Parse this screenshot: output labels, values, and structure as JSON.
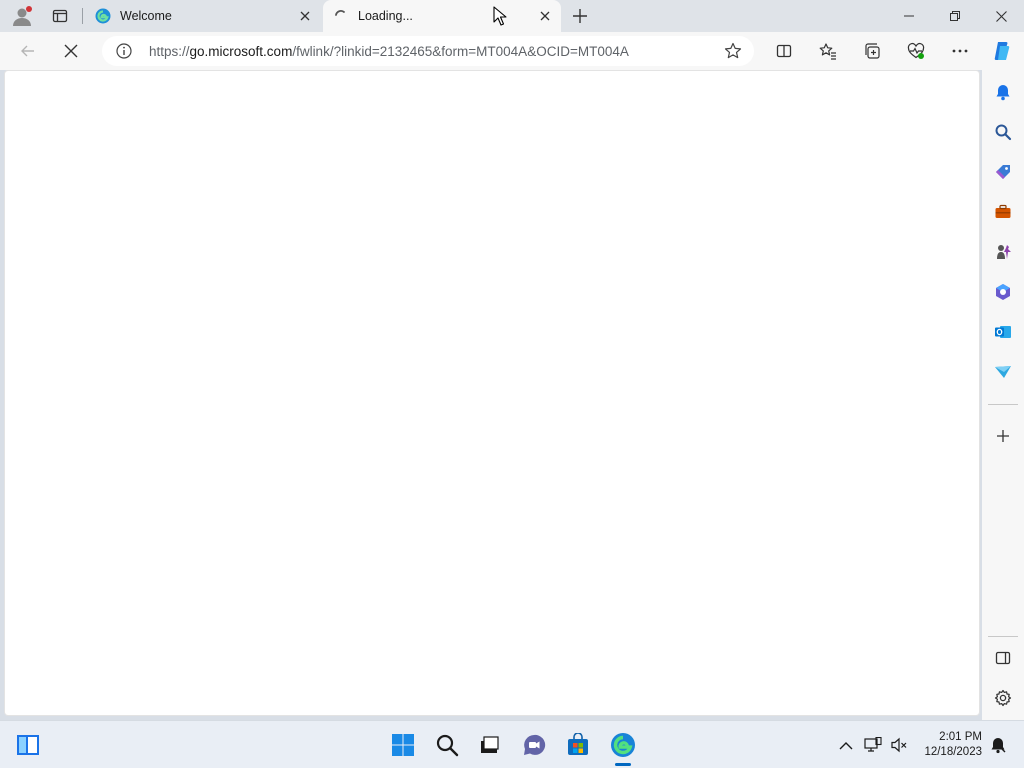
{
  "tabs": [
    {
      "title": "Welcome",
      "state": "inactive",
      "favicon": "edge-icon"
    },
    {
      "title": "Loading...",
      "state": "active",
      "favicon": "loading-spinner-icon"
    }
  ],
  "address_bar": {
    "url_prefix": "https://",
    "url_host": "go.microsoft.com",
    "url_rest": "/fwlink/?linkid=2132465&form=MT004A&OCID=MT004A"
  },
  "toolbar": {
    "icons": [
      "back-icon",
      "stop-loading-icon",
      "split-screen-icon",
      "favorites-icon",
      "collections-icon",
      "browser-essentials-icon",
      "more-menu-icon",
      "copilot-icon"
    ]
  },
  "sidebar": {
    "icons": [
      "notifications-icon",
      "search-icon",
      "shopping-icon",
      "tools-icon",
      "games-icon",
      "microsoft-365-icon",
      "outlook-icon",
      "drop-icon",
      "add-icon",
      "hide-sidebar-icon",
      "settings-icon"
    ]
  },
  "taskbar": {
    "icons": [
      "widgets-icon",
      "start-icon",
      "search-icon",
      "task-view-icon",
      "teams-chat-icon",
      "store-icon",
      "edge-icon"
    ],
    "tray_icons": [
      "show-hidden-icon",
      "network-icon",
      "volume-muted-icon",
      "notification-icon"
    ],
    "time": "2:01 PM",
    "date": "12/18/2023"
  },
  "colors": {
    "accent": "#0067c0",
    "tab_bar": "#dfe3e8",
    "toolbar": "#f7f7f7",
    "taskbar": "#e9eef5"
  }
}
